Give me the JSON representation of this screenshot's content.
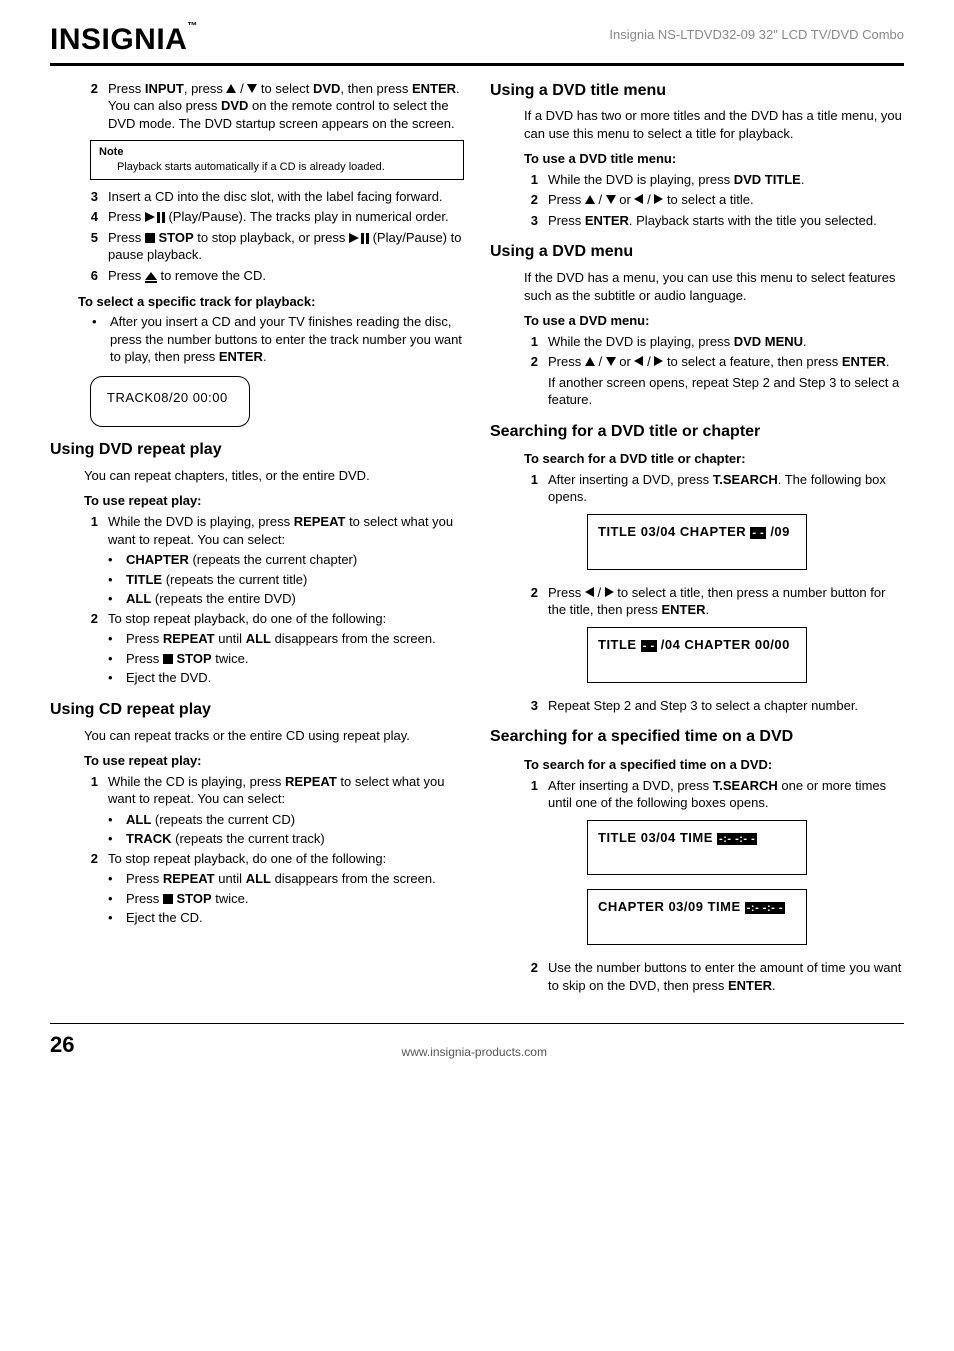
{
  "header": {
    "logo": "INSIGNIA",
    "product": "Insignia NS-LTDVD32-09 32\" LCD TV/DVD Combo"
  },
  "left": {
    "step2": {
      "num": "2",
      "a": "Press ",
      "b": "INPUT",
      "c": ", press ",
      "d": " / ",
      "e": " to select ",
      "f": "DVD",
      "g": ", then press ",
      "h": "ENTER",
      "i": ". You can also press ",
      "j": "DVD",
      "k": " on the remote control to select the DVD mode. The DVD startup screen appears on the screen."
    },
    "note": {
      "label": "Note",
      "text": "Playback starts automatically if a CD is already loaded."
    },
    "step3": {
      "num": "3",
      "text": "Insert a CD into the disc slot, with the label facing forward."
    },
    "step4": {
      "num": "4",
      "a": "Press ",
      "b": " (Play/Pause). The tracks play in numerical order."
    },
    "step5": {
      "num": "5",
      "a": "Press ",
      "b": " STOP",
      "c": " to stop playback, or press ",
      "d": " (Play/Pause) to pause playback."
    },
    "step6": {
      "num": "6",
      "a": "Press ",
      "b": " to remove the CD."
    },
    "track_head": "To select a specific track for playback:",
    "track_bullet": {
      "a": "After you insert a CD and your TV finishes reading the disc, press the number buttons to enter the track number you want to play, then press ",
      "b": "ENTER",
      "c": "."
    },
    "track_box": "TRACK08/20   00:00",
    "dvd_repeat": {
      "title": "Using DVD repeat play",
      "intro": "You can repeat chapters, titles, or the entire DVD.",
      "sub": "To use repeat play:",
      "s1": {
        "num": "1",
        "a": "While the DVD is playing, press ",
        "b": "REPEAT",
        "c": " to select what you want to repeat. You can select:"
      },
      "b1": {
        "a": "CHAPTER",
        "b": " (repeats the current chapter)"
      },
      "b2": {
        "a": "TITLE",
        "b": " (repeats the current title)"
      },
      "b3": {
        "a": "ALL",
        "b": " (repeats the entire DVD)"
      },
      "s2": {
        "num": "2",
        "text": "To stop repeat playback, do one of the following:"
      },
      "c1": {
        "a": "Press ",
        "b": "REPEAT",
        "c": " until ",
        "d": "ALL",
        "e": " disappears from the screen."
      },
      "c2": {
        "a": "Press ",
        "b": " STOP",
        "c": " twice."
      },
      "c3": "Eject the DVD."
    },
    "cd_repeat": {
      "title": "Using CD repeat play",
      "intro": "You can repeat tracks or the entire CD using repeat play.",
      "sub": "To use repeat play:",
      "s1": {
        "num": "1",
        "a": "While the CD is playing, press ",
        "b": "REPEAT",
        "c": " to select what you want to repeat. You can select:"
      },
      "b1": {
        "a": "ALL",
        "b": " (repeats the current CD)"
      },
      "b2": {
        "a": "TRACK",
        "b": " (repeats the current track)"
      },
      "s2": {
        "num": "2",
        "text": "To stop repeat playback, do one of the following:"
      },
      "c1": {
        "a": "Press ",
        "b": "REPEAT",
        "c": " until ",
        "d": "ALL",
        "e": " disappears from the screen."
      },
      "c2": {
        "a": "Press ",
        "b": " STOP",
        "c": " twice."
      },
      "c3": "Eject the CD."
    }
  },
  "right": {
    "title_menu": {
      "title": "Using a DVD title menu",
      "intro": "If a DVD has two or more titles and the DVD has a title menu, you can use this menu to select a title for playback.",
      "sub": "To use a DVD title menu:",
      "s1": {
        "num": "1",
        "a": "While the DVD is playing, press ",
        "b": "DVD TITLE",
        "c": "."
      },
      "s2": {
        "num": "2",
        "a": "Press ",
        "b": " / ",
        "c": " or ",
        "d": " / ",
        "e": " to select a title."
      },
      "s3": {
        "num": "3",
        "a": "Press ",
        "b": "ENTER",
        "c": ". Playback starts with the title you selected."
      }
    },
    "dvd_menu": {
      "title": "Using a DVD menu",
      "intro": "If the DVD has a menu, you can use this menu to select features such as the subtitle or audio language.",
      "sub": "To use a DVD menu:",
      "s1": {
        "num": "1",
        "a": "While the DVD is playing, press ",
        "b": "DVD MENU",
        "c": "."
      },
      "s2": {
        "num": "2",
        "a": "Press ",
        "b": " / ",
        "c": " or ",
        "d": " / ",
        "e": "  to select a feature, then press ",
        "f": "ENTER",
        "g": "."
      },
      "s2b": "If another screen opens, repeat Step 2 and Step 3 to select a feature."
    },
    "search_title": {
      "title": "Searching for a DVD title or chapter",
      "sub": "To search for a DVD title or chapter:",
      "s1": {
        "num": "1",
        "a": "After inserting a DVD, press ",
        "b": "T.SEARCH",
        "c": ". The following box opens."
      },
      "box1a": "TITLE 03/04   CHAPTER ",
      "box1b": "- -",
      "box1c": " /09",
      "s2": {
        "num": "2",
        "a": "Press ",
        "b": " / ",
        "c": "  to select a title, then press a number button for the title, then press ",
        "d": "ENTER",
        "e": "."
      },
      "box2a": "TITLE ",
      "box2b": "- -",
      "box2c": " /04   CHAPTER 00/00",
      "s3": {
        "num": "3",
        "text": "Repeat Step 2 and Step 3 to select a chapter number."
      }
    },
    "search_time": {
      "title": "Searching for a specified time on a DVD",
      "sub": "To search for a specified time on a DVD:",
      "s1": {
        "num": "1",
        "a": "After inserting a DVD, press ",
        "b": "T.SEARCH",
        "c": " one or more times until one of the following boxes opens."
      },
      "box1a": "TITLE 03/04   TIME ",
      "box1b": "-:- -:- -",
      "box2a": "CHAPTER 03/09   TIME ",
      "box2b": "-:- -:- -",
      "s2": {
        "num": "2",
        "a": "Use the number buttons to enter the amount of time you want to skip on the DVD, then press ",
        "b": "ENTER",
        "c": "."
      }
    }
  },
  "footer": {
    "page": "26",
    "url": "www.insignia-products.com"
  }
}
